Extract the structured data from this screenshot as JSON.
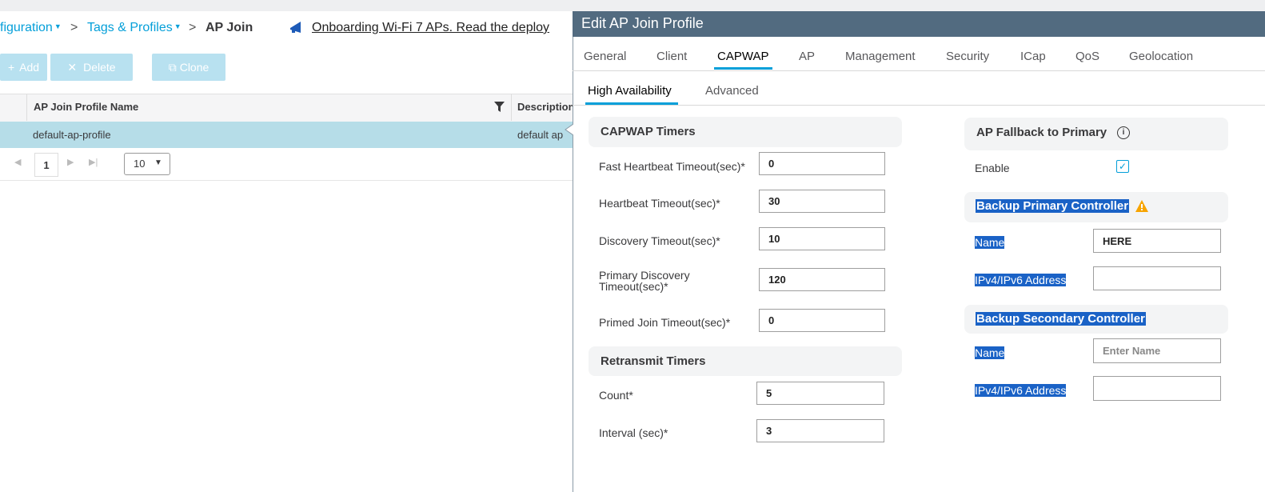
{
  "breadcrumb": {
    "configuration": "figuration",
    "tags_profiles": "Tags & Profiles",
    "current": "AP Join",
    "separator": ">"
  },
  "banner": {
    "text": "Onboarding Wi-Fi 7 APs. Read the deploy"
  },
  "toolbar": {
    "add": "Add",
    "delete": "Delete",
    "clone": "Clone"
  },
  "table": {
    "col_name": "AP Join Profile Name",
    "col_desc": "Description",
    "row": {
      "name": "default-ap-profile",
      "desc": "default ap"
    }
  },
  "pager": {
    "page": "1",
    "page_size": "10"
  },
  "panel": {
    "title": "Edit AP Join Profile",
    "tabs": [
      "General",
      "Client",
      "CAPWAP",
      "AP",
      "Management",
      "Security",
      "ICap",
      "QoS",
      "Geolocation"
    ],
    "active_tab": "CAPWAP",
    "subtabs": [
      "High Availability",
      "Advanced"
    ],
    "capwap_timers": {
      "title": "CAPWAP Timers",
      "fast_hb_label": "Fast Heartbeat Timeout(sec)*",
      "fast_hb": "0",
      "hb_label": "Heartbeat Timeout(sec)*",
      "hb": "30",
      "disc_label": "Discovery Timeout(sec)*",
      "disc": "10",
      "prim_disc_label_1": "Primary Discovery",
      "prim_disc_label_2": "Timeout(sec)*",
      "prim_disc": "120",
      "primed_label": "Primed Join Timeout(sec)*",
      "primed": "0"
    },
    "retransmit": {
      "title": "Retransmit Timers",
      "count_label": "Count*",
      "count": "5",
      "interval_label": "Interval (sec)*",
      "interval": "3"
    },
    "fallback": {
      "title": "AP Fallback to Primary",
      "enable_label": "Enable",
      "enabled": true
    },
    "backup_primary": {
      "title": "Backup Primary Controller",
      "name_label": "Name",
      "name": "HERE",
      "ip_label": "IPv4/IPv6 Address",
      "ip": ""
    },
    "backup_secondary": {
      "title": "Backup Secondary Controller",
      "name_label": "Name",
      "name_placeholder": "Enter Name",
      "ip_label": "IPv4/IPv6 Address",
      "ip": ""
    }
  },
  "colors": {
    "header": "#526b80",
    "accent": "#049fd9",
    "selection": "#1a62c6",
    "row_selected": "#b6dde8",
    "warning": "#f7a400"
  }
}
